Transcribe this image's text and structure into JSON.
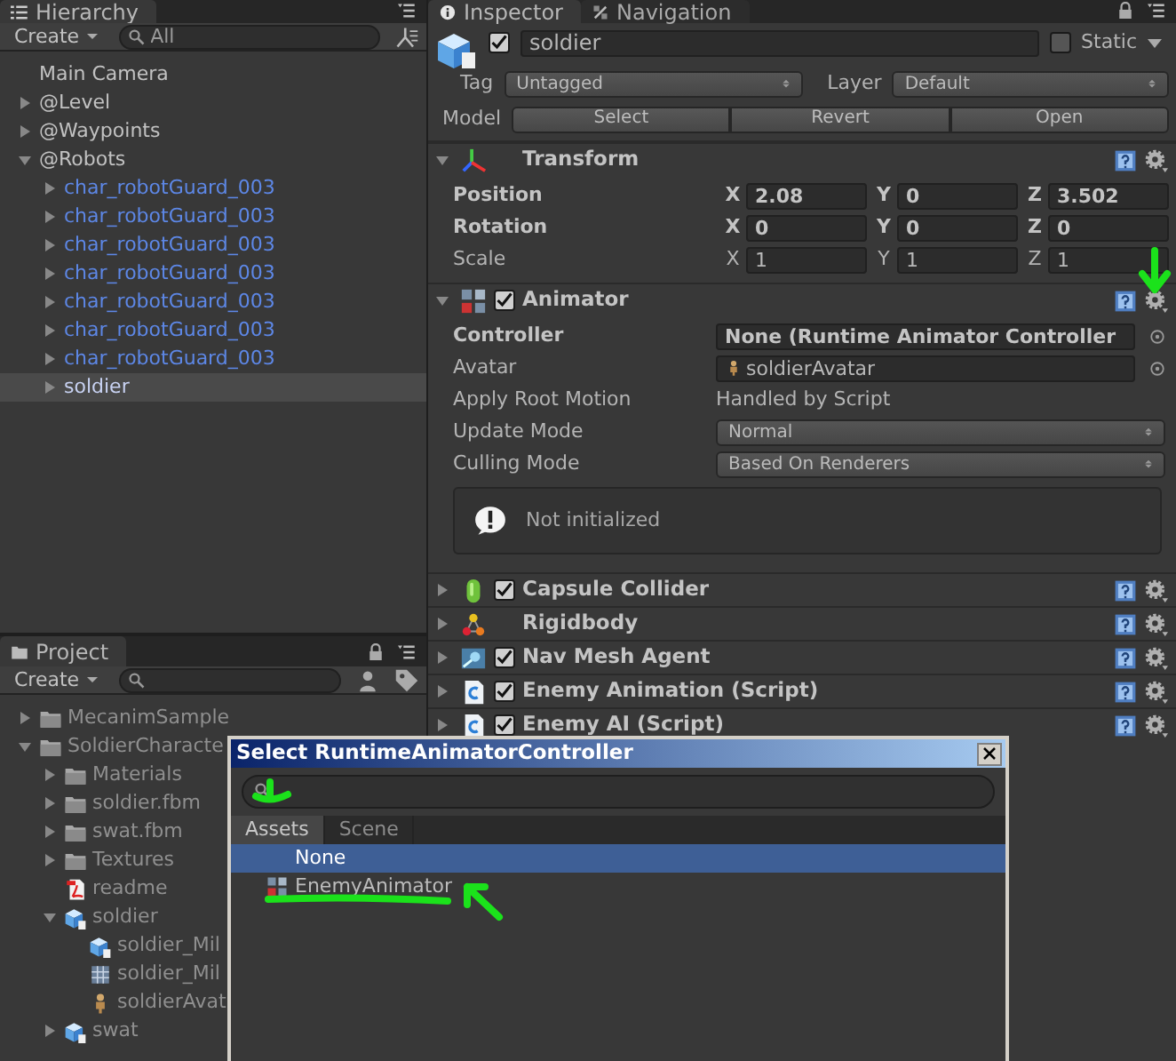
{
  "hierarchy": {
    "title": "Hierarchy",
    "create_label": "Create",
    "search_placeholder": "All",
    "items": [
      {
        "label": "Main Camera",
        "kind": "object",
        "selected": false
      },
      {
        "label": "@Level",
        "kind": "object",
        "expanded": false,
        "selected": false
      },
      {
        "label": "@Waypoints",
        "kind": "object",
        "expanded": false,
        "selected": false
      },
      {
        "label": "@Robots",
        "kind": "object",
        "expanded": true,
        "selected": false,
        "children": [
          {
            "label": "char_robotGuard_003",
            "kind": "prefab",
            "expanded": false,
            "selected": false
          },
          {
            "label": "char_robotGuard_003",
            "kind": "prefab",
            "expanded": false,
            "selected": false
          },
          {
            "label": "char_robotGuard_003",
            "kind": "prefab",
            "expanded": false,
            "selected": false
          },
          {
            "label": "char_robotGuard_003",
            "kind": "prefab",
            "expanded": false,
            "selected": false
          },
          {
            "label": "char_robotGuard_003",
            "kind": "prefab",
            "expanded": false,
            "selected": false
          },
          {
            "label": "char_robotGuard_003",
            "kind": "prefab",
            "expanded": false,
            "selected": false
          },
          {
            "label": "char_robotGuard_003",
            "kind": "prefab",
            "expanded": false,
            "selected": false
          },
          {
            "label": "soldier",
            "kind": "prefab",
            "expanded": false,
            "selected": true
          }
        ]
      }
    ]
  },
  "project": {
    "title": "Project",
    "create_label": "Create",
    "items": [
      {
        "label": "MecanimSample",
        "kind": "folder",
        "expanded": false
      },
      {
        "label": "SoldierCharacte",
        "kind": "folder",
        "expanded": true,
        "children": [
          {
            "label": "Materials",
            "kind": "folder",
            "expanded": false
          },
          {
            "label": "soldier.fbm",
            "kind": "folder",
            "expanded": false
          },
          {
            "label": "swat.fbm",
            "kind": "folder",
            "expanded": false
          },
          {
            "label": "Textures",
            "kind": "folder",
            "expanded": false
          },
          {
            "label": "readme",
            "kind": "pdf"
          },
          {
            "label": "soldier",
            "kind": "model",
            "expanded": true,
            "children": [
              {
                "label": "soldier_Mil",
                "kind": "model"
              },
              {
                "label": "soldier_Mil",
                "kind": "grid"
              },
              {
                "label": "soldierAvat",
                "kind": "avatar"
              }
            ]
          },
          {
            "label": "swat",
            "kind": "model",
            "expanded": false
          }
        ]
      }
    ]
  },
  "inspector": {
    "tabs": [
      {
        "label": "Inspector",
        "selected": true
      },
      {
        "label": "Navigation",
        "selected": false
      }
    ],
    "game_object": {
      "active": true,
      "name": "soldier",
      "static": false,
      "static_label": "Static",
      "tag_label": "Tag",
      "tag": "Untagged",
      "layer_label": "Layer",
      "layer": "Default",
      "model_label": "Model",
      "model_buttons": [
        "Select",
        "Revert",
        "Open"
      ]
    },
    "components": [
      {
        "kind": "transform",
        "title": "Transform",
        "expanded": true,
        "rows": [
          {
            "label": "Position",
            "modified": true,
            "values": [
              {
                "axis": "X",
                "value": "2.08"
              },
              {
                "axis": "Y",
                "value": "0"
              },
              {
                "axis": "Z",
                "value": "3.502"
              }
            ]
          },
          {
            "label": "Rotation",
            "modified": true,
            "values": [
              {
                "axis": "X",
                "value": "0"
              },
              {
                "axis": "Y",
                "value": "0"
              },
              {
                "axis": "Z",
                "value": "0"
              }
            ]
          },
          {
            "label": "Scale",
            "modified": false,
            "values": [
              {
                "axis": "X",
                "value": "1"
              },
              {
                "axis": "Y",
                "value": "1"
              },
              {
                "axis": "Z",
                "value": "1"
              }
            ]
          }
        ]
      },
      {
        "kind": "animator",
        "title": "Animator",
        "expanded": true,
        "enabled": true,
        "fields": [
          {
            "kind": "object",
            "label": "Controller",
            "value": "None (Runtime Animator Controller",
            "modified": true
          },
          {
            "kind": "avatar",
            "label": "Avatar",
            "value": "soldierAvatar",
            "modified": false
          },
          {
            "kind": "text",
            "label": "Apply Root Motion",
            "value": "Handled by Script",
            "modified": false
          },
          {
            "kind": "popup",
            "label": "Update Mode",
            "value": "Normal",
            "modified": false
          },
          {
            "kind": "popup",
            "label": "Culling Mode",
            "value": "Based On Renderers",
            "modified": false
          }
        ],
        "message": "Not initialized"
      },
      {
        "kind": "capsule",
        "title": "Capsule Collider",
        "expanded": false,
        "enabled": true
      },
      {
        "kind": "rigidbody",
        "title": "Rigidbody",
        "expanded": false
      },
      {
        "kind": "navmesh",
        "title": "Nav Mesh Agent",
        "expanded": false,
        "enabled": true
      },
      {
        "kind": "script",
        "title": "Enemy Animation (Script)",
        "expanded": false,
        "enabled": true
      },
      {
        "kind": "script",
        "title": "Enemy AI (Script)",
        "expanded": false,
        "enabled": true
      }
    ]
  },
  "dialog": {
    "title": "Select RuntimeAnimatorController",
    "tabs": [
      {
        "label": "Assets",
        "selected": true
      },
      {
        "label": "Scene",
        "selected": false
      }
    ],
    "items": [
      {
        "label": "None",
        "kind": "none",
        "selected": true
      },
      {
        "label": "EnemyAnimator",
        "kind": "animator",
        "selected": false
      }
    ]
  }
}
